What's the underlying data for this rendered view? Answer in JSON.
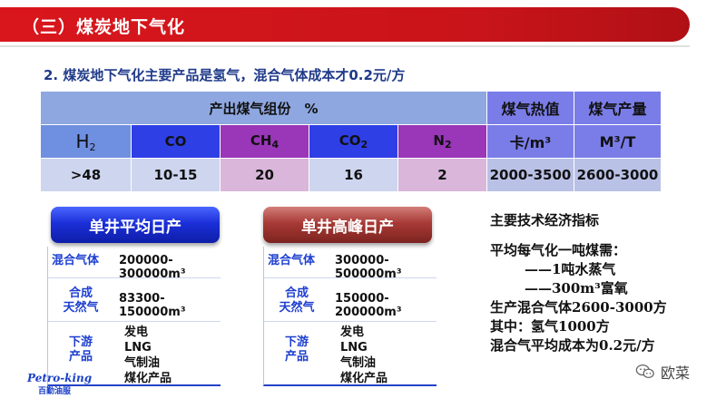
{
  "header": {
    "title": "（三）煤炭地下气化"
  },
  "subtitle": "2. 煤炭地下气化主要产品是氢气，混合气体成本才0.2元/方",
  "table": {
    "group_header": "产出煤气组份　%",
    "heat_header": "煤气热值",
    "output_header": "煤气产量",
    "components": [
      {
        "base": "H",
        "sub": "2"
      },
      {
        "base": "CO",
        "sub": ""
      },
      {
        "base": "CH",
        "sub": "4"
      },
      {
        "base": "CO",
        "sub": "2"
      },
      {
        "base": "N",
        "sub": "2"
      }
    ],
    "heat_unit": "卡/m³",
    "output_unit": "M³/T",
    "values": [
      ">48",
      "10-15",
      "20",
      "16",
      "2"
    ],
    "heat_value": "2000-3500",
    "output_value": "2600-3000"
  },
  "cards": [
    {
      "title": "单井平均日产",
      "mixed_label": "混合气体",
      "mixed_value": "200000-300000m³",
      "syngas_label": [
        "合成",
        "天然气"
      ],
      "syngas_value": "83300-150000m³",
      "downstream_label": [
        "下游",
        "产品"
      ],
      "products": [
        "发电",
        "LNG",
        "气制油",
        "煤化产品"
      ]
    },
    {
      "title": "单井高峰日产",
      "mixed_label": "混合气体",
      "mixed_value": "300000-500000m³",
      "syngas_label": [
        "合成",
        "天然气"
      ],
      "syngas_value": "150000-200000m³",
      "downstream_label": [
        "下游",
        "产品"
      ],
      "products": [
        "发电",
        "LNG",
        "气制油",
        "煤化产品"
      ]
    }
  ],
  "info": {
    "title": "主要技术经济指标",
    "lines": [
      "平均每气化一吨煤需：",
      "——1吨水蒸气",
      "——300m³富氧",
      "生产混合气体2600-3000方",
      "其中：氢气1000方",
      "混合气平均成本为0.2元/方"
    ]
  },
  "logo": {
    "en": "Petro-king",
    "cn": "百勤油服"
  },
  "watermark": {
    "text": "欧菜"
  },
  "colors": {
    "header_red": "#d9161c",
    "table_blue": "#2e3fe6",
    "table_purple": "#9a36b8",
    "label_blue": "#1d3fd0"
  }
}
